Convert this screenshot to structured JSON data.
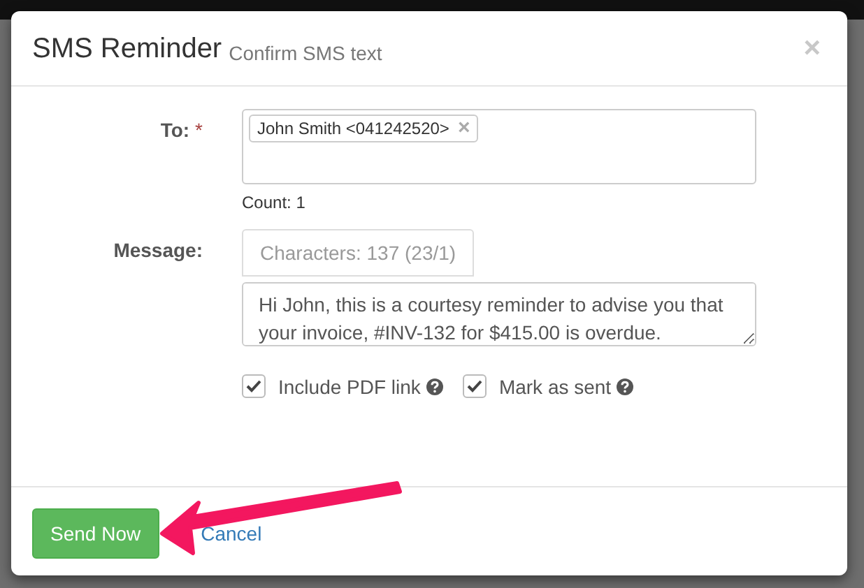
{
  "dialog": {
    "title": "SMS Reminder",
    "subtitle": "Confirm SMS text",
    "close": "×"
  },
  "fields": [
    {
      "kind": "recipients",
      "label": "To:",
      "required_mark": "*",
      "tags": [
        {
          "text": "John Smith <041242520>",
          "remove": "×"
        }
      ],
      "help": "Count: 1"
    },
    {
      "kind": "message",
      "label": "Message:",
      "counter": "Characters: 137 (23/1)",
      "value": "Hi John, this is a courtesy reminder to advise you that your invoice, #INV-132 for $415.00 is overdue."
    }
  ],
  "options": [
    {
      "label": "Include PDF link",
      "checked": true
    },
    {
      "label": "Mark as sent",
      "checked": true
    }
  ],
  "buttons": [
    {
      "kind": "primary",
      "label": "Send Now"
    },
    {
      "kind": "link",
      "label": "Cancel"
    }
  ]
}
